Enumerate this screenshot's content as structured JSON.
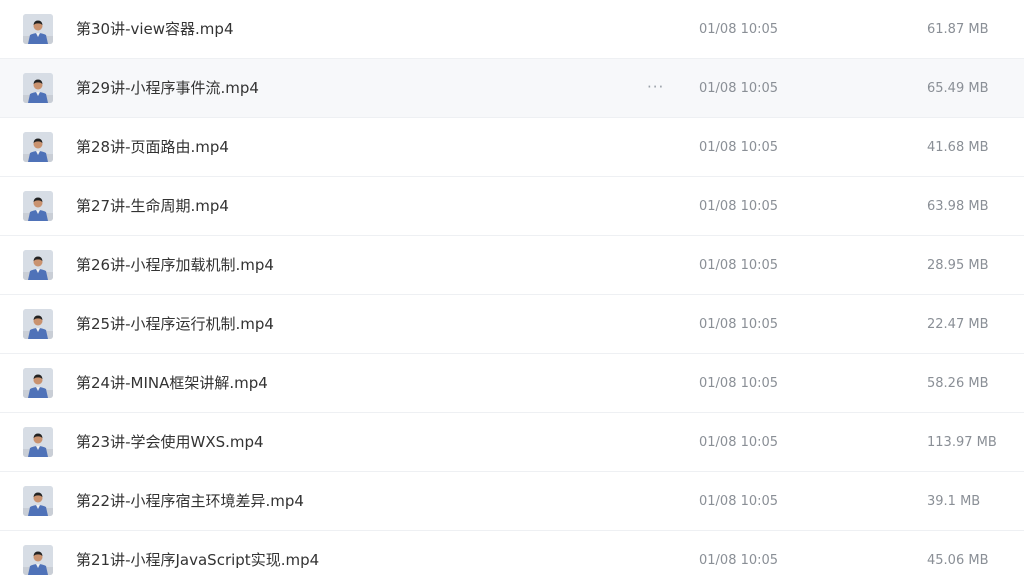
{
  "files": [
    {
      "name": "第30讲-view容器.mp4",
      "date": "01/08 10:05",
      "size": "61.87 MB",
      "thumbnail_icon": "video-thumbnail-presenter"
    },
    {
      "name": "第29讲-小程序事件流.mp4",
      "date": "01/08 10:05",
      "size": "65.49 MB",
      "thumbnail_icon": "video-thumbnail-presenter",
      "hovered": true,
      "more_label": "···"
    },
    {
      "name": "第28讲-页面路由.mp4",
      "date": "01/08 10:05",
      "size": "41.68 MB",
      "thumbnail_icon": "video-thumbnail-presenter"
    },
    {
      "name": "第27讲-生命周期.mp4",
      "date": "01/08 10:05",
      "size": "63.98 MB",
      "thumbnail_icon": "video-thumbnail-presenter"
    },
    {
      "name": "第26讲-小程序加载机制.mp4",
      "date": "01/08 10:05",
      "size": "28.95 MB",
      "thumbnail_icon": "video-thumbnail-presenter"
    },
    {
      "name": "第25讲-小程序运行机制.mp4",
      "date": "01/08 10:05",
      "size": "22.47 MB",
      "thumbnail_icon": "video-thumbnail-presenter"
    },
    {
      "name": "第24讲-MINA框架讲解.mp4",
      "date": "01/08 10:05",
      "size": "58.26 MB",
      "thumbnail_icon": "video-thumbnail-presenter"
    },
    {
      "name": "第23讲-学会使用WXS.mp4",
      "date": "01/08 10:05",
      "size": "113.97 MB",
      "thumbnail_icon": "video-thumbnail-presenter"
    },
    {
      "name": "第22讲-小程序宿主环境差异.mp4",
      "date": "01/08 10:05",
      "size": "39.1 MB",
      "thumbnail_icon": "video-thumbnail-presenter"
    },
    {
      "name": "第21讲-小程序JavaScript实现.mp4",
      "date": "01/08 10:05",
      "size": "45.06 MB",
      "thumbnail_icon": "video-thumbnail-presenter"
    }
  ]
}
